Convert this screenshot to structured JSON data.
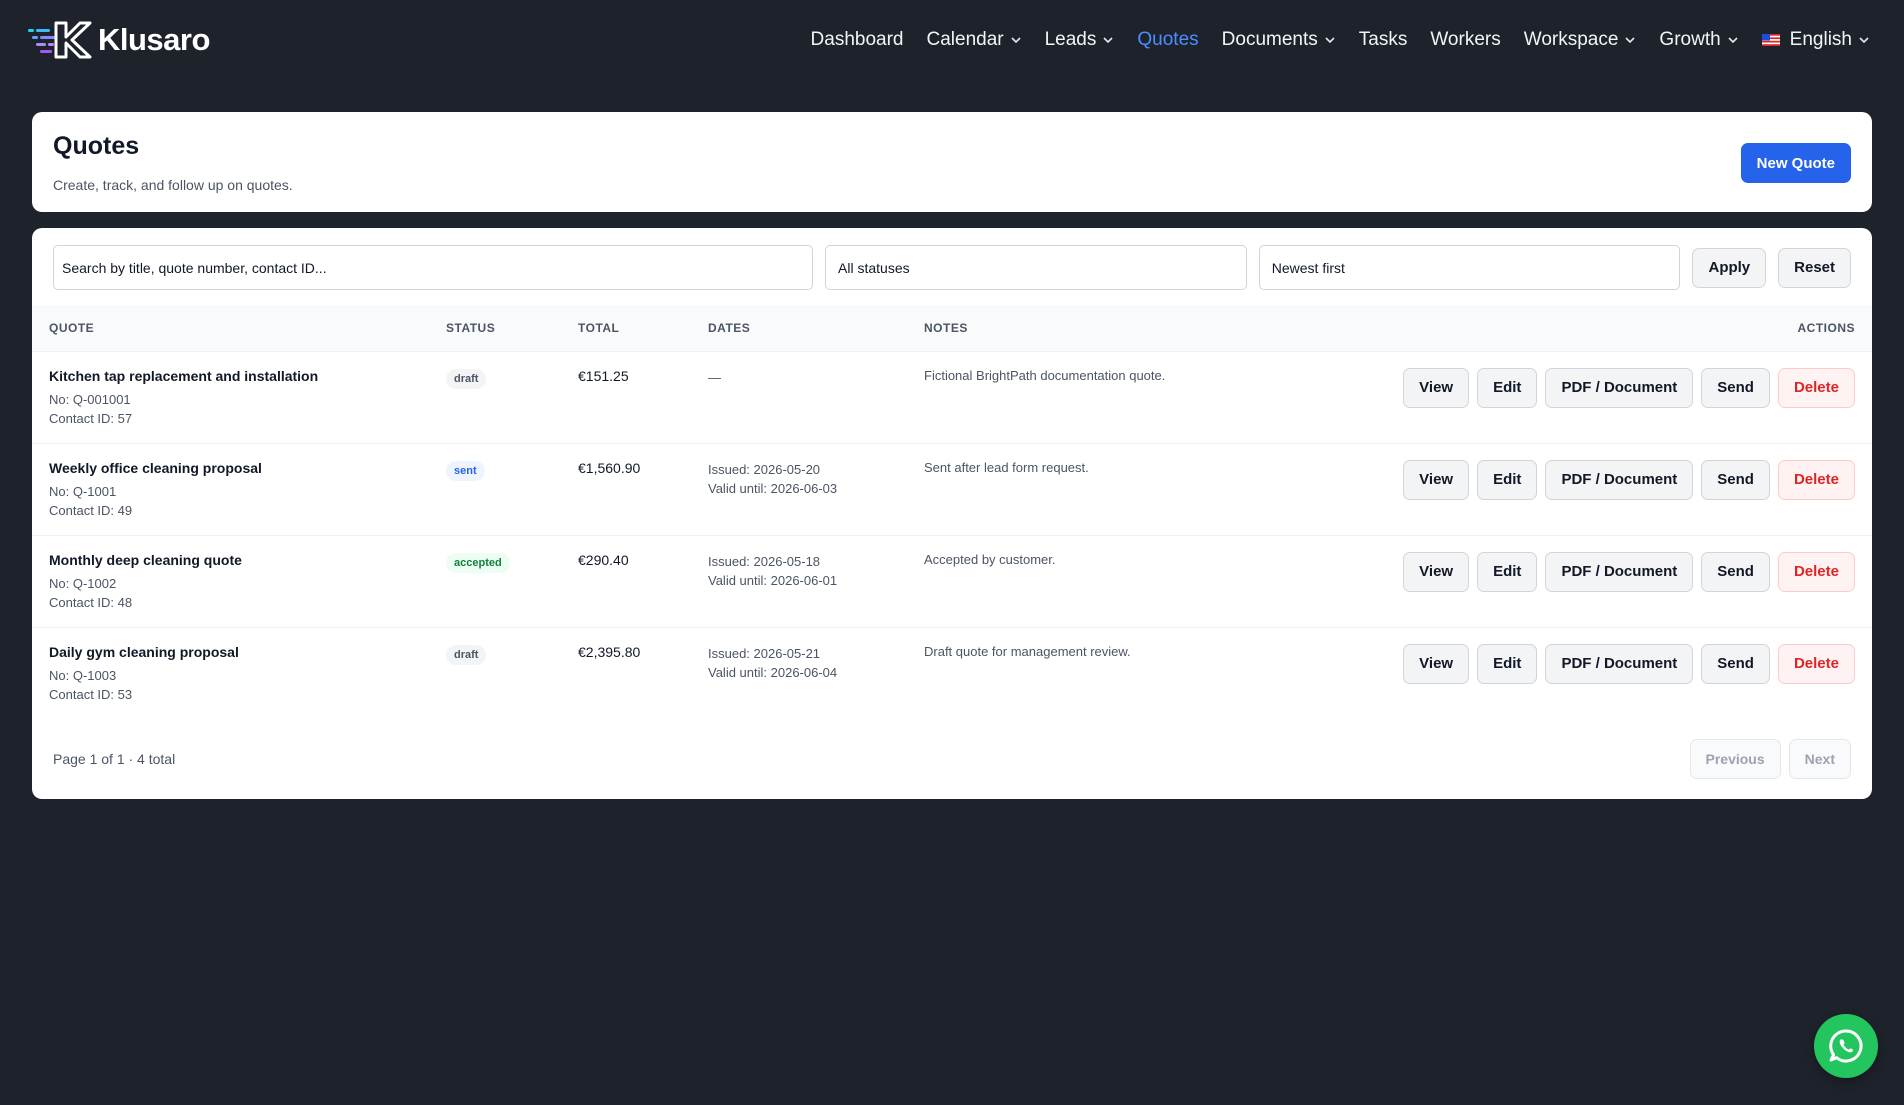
{
  "brand": {
    "name": "Klusaro"
  },
  "nav": {
    "items": [
      {
        "label": "Dashboard",
        "dropdown": false
      },
      {
        "label": "Calendar",
        "dropdown": true
      },
      {
        "label": "Leads",
        "dropdown": true
      },
      {
        "label": "Quotes",
        "dropdown": false,
        "active": true
      },
      {
        "label": "Documents",
        "dropdown": true
      },
      {
        "label": "Tasks",
        "dropdown": false
      },
      {
        "label": "Workers",
        "dropdown": false
      },
      {
        "label": "Workspace",
        "dropdown": true
      },
      {
        "label": "Growth",
        "dropdown": true
      }
    ],
    "language": "English"
  },
  "header": {
    "title": "Quotes",
    "subtitle": "Create, track, and follow up on quotes.",
    "new_button": "New Quote"
  },
  "filters": {
    "search_placeholder": "Search by title, quote number, contact ID...",
    "status_value": "All statuses",
    "sort_value": "Newest first",
    "apply_label": "Apply",
    "reset_label": "Reset"
  },
  "table": {
    "columns": {
      "quote": "Quote",
      "status": "Status",
      "total": "Total",
      "dates": "Dates",
      "notes": "Notes",
      "actions": "Actions"
    },
    "action_labels": {
      "view": "View",
      "edit": "Edit",
      "pdf": "PDF / Document",
      "send": "Send",
      "delete": "Delete"
    },
    "rows": [
      {
        "title": "Kitchen tap replacement and installation",
        "number": "No: Q-001001",
        "contact": "Contact ID: 57",
        "status": "draft",
        "total": "€151.25",
        "issued": "—",
        "valid": "",
        "notes": "Fictional BrightPath documentation quote."
      },
      {
        "title": "Weekly office cleaning proposal",
        "number": "No: Q-1001",
        "contact": "Contact ID: 49",
        "status": "sent",
        "total": "€1,560.90",
        "issued": "Issued: 2026-05-20",
        "valid": "Valid until: 2026-06-03",
        "notes": "Sent after lead form request."
      },
      {
        "title": "Monthly deep cleaning quote",
        "number": "No: Q-1002",
        "contact": "Contact ID: 48",
        "status": "accepted",
        "total": "€290.40",
        "issued": "Issued: 2026-05-18",
        "valid": "Valid until: 2026-06-01",
        "notes": "Accepted by customer."
      },
      {
        "title": "Daily gym cleaning proposal",
        "number": "No: Q-1003",
        "contact": "Contact ID: 53",
        "status": "draft",
        "total": "€2,395.80",
        "issued": "Issued: 2026-05-21",
        "valid": "Valid until: 2026-06-04",
        "notes": "Draft quote for management review."
      }
    ]
  },
  "pagination": {
    "summary": "Page 1 of 1 · 4 total",
    "previous_label": "Previous",
    "next_label": "Next"
  },
  "colors": {
    "accent": "#2563eb",
    "nav_active": "#4c8dff",
    "danger": "#dc2626",
    "background": "#1e222b",
    "whatsapp": "#22c55e"
  }
}
